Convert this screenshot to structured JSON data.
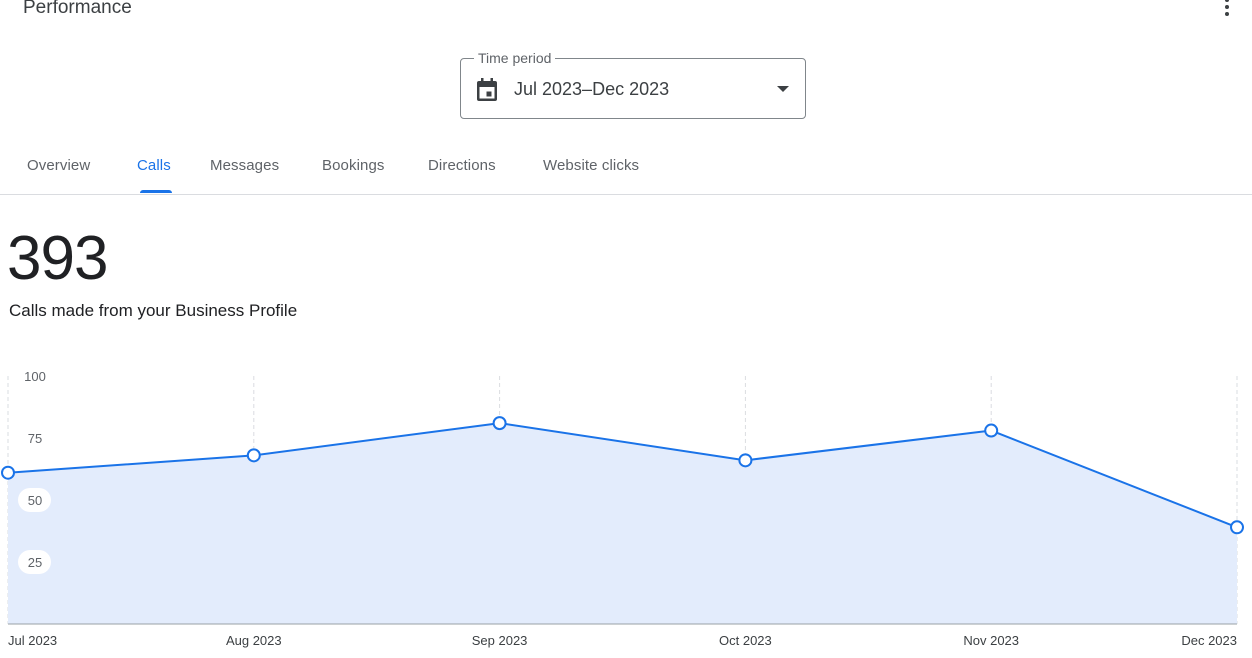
{
  "header": {
    "title": "Performance",
    "more_icon": "more-vert-icon"
  },
  "time_period": {
    "label": "Time period",
    "value": "Jul 2023–Dec 2023",
    "calendar_icon": "calendar-icon",
    "dropdown_icon": "arrow-drop-down-icon"
  },
  "tabs": [
    {
      "label": "Overview",
      "active": false
    },
    {
      "label": "Calls",
      "active": true
    },
    {
      "label": "Messages",
      "active": false
    },
    {
      "label": "Bookings",
      "active": false
    },
    {
      "label": "Directions",
      "active": false
    },
    {
      "label": "Website clicks",
      "active": false
    }
  ],
  "metric": {
    "value": "393",
    "description": "Calls made from your Business Profile"
  },
  "colors": {
    "accent": "#1a73e8",
    "area_fill": "#e3ecfc",
    "grid": "#dadce0",
    "text_muted": "#5f6368"
  },
  "chart_data": {
    "type": "area",
    "categories": [
      "Jul 2023",
      "Aug 2023",
      "Sep 2023",
      "Oct 2023",
      "Nov 2023",
      "Dec 2023"
    ],
    "values": [
      61,
      68,
      81,
      66,
      78,
      39
    ],
    "yticks": [
      100,
      75,
      50,
      25
    ],
    "ylim": [
      0,
      100
    ],
    "xlabel": "",
    "ylabel": "",
    "grid": "vertical dashed",
    "markers": "hollow circles"
  }
}
